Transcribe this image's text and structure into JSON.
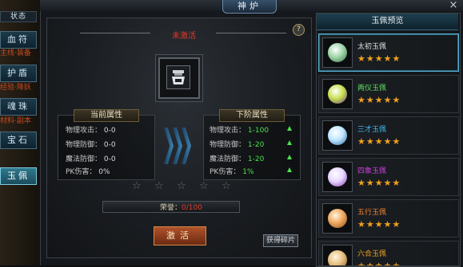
{
  "window": {
    "title": "神炉",
    "close": "×"
  },
  "side": {
    "top_text": "状态",
    "tabs": [
      {
        "label": "血符",
        "active": false
      },
      {
        "label": "护盾",
        "active": false
      },
      {
        "label": "魂珠",
        "active": false
      },
      {
        "label": "宝石",
        "active": false
      },
      {
        "label": "玉佩",
        "active": true
      }
    ],
    "notes": [
      "主线·装备",
      "经验·降妖",
      "材料·副本"
    ]
  },
  "forge": {
    "status": "未激活",
    "help": "?",
    "current": {
      "title": "当前属性",
      "rows": [
        {
          "label": "物理攻击：",
          "value": "0-0"
        },
        {
          "label": "物理防御：",
          "value": "0-0"
        },
        {
          "label": "魔法防御：",
          "value": "0-0"
        },
        {
          "label": "PK伤害：",
          "value": "0%"
        }
      ]
    },
    "next": {
      "title": "下阶属性",
      "rows": [
        {
          "label": "物理攻击：",
          "value": "1-100"
        },
        {
          "label": "物理防御：",
          "value": "1-20"
        },
        {
          "label": "魔法防御：",
          "value": "1-20"
        },
        {
          "label": "PK伤害：",
          "value": "1%"
        }
      ]
    },
    "star_count": 5,
    "stars_filled": 0,
    "honor_label": "荣誉：",
    "honor_value": "0/100",
    "activate_label": "激活",
    "fragment_label": "获得碎片"
  },
  "preview": {
    "title": "玉佩预览",
    "items": [
      {
        "name": "太初玉佩",
        "color": "#e0e0e0",
        "gem": "#9fd6a8",
        "stars": "★★★★★"
      },
      {
        "name": "两仪玉佩",
        "color": "#5ee05e",
        "gem": "#c8e050",
        "stars": "★★★★★"
      },
      {
        "name": "三才玉佩",
        "color": "#40b8f0",
        "gem": "#bfe6ff",
        "stars": "★★★★★"
      },
      {
        "name": "四象玉佩",
        "color": "#d040e0",
        "gem": "#e6d6ff",
        "stars": "★★★★★"
      },
      {
        "name": "五行玉佩",
        "color": "#f08030",
        "gem": "#f0a860",
        "stars": "★★★★★"
      },
      {
        "name": "六合玉佩",
        "color": "#f0a020",
        "gem": "#e6c080",
        "stars": "★★★★★"
      }
    ]
  }
}
